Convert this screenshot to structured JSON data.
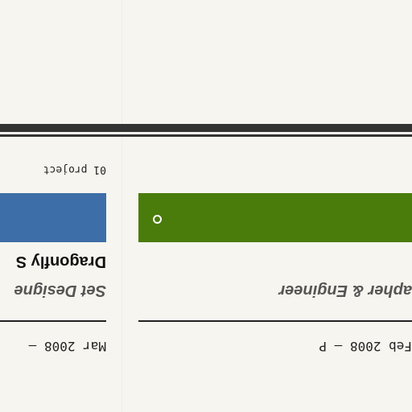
{
  "section": {
    "project_count": "01 project"
  },
  "cards": [
    {
      "title": "Dragonfly S",
      "role": "Set Designe",
      "dates": "Mar 2008 – ",
      "accent": "#3e6ea7"
    },
    {
      "title": "",
      "role": "apher & Engineer",
      "dates": "Feb 2008 – P",
      "accent": "#4a7c0b"
    }
  ],
  "colors": {
    "background": "#f6f5ef",
    "rule": "#333333"
  }
}
